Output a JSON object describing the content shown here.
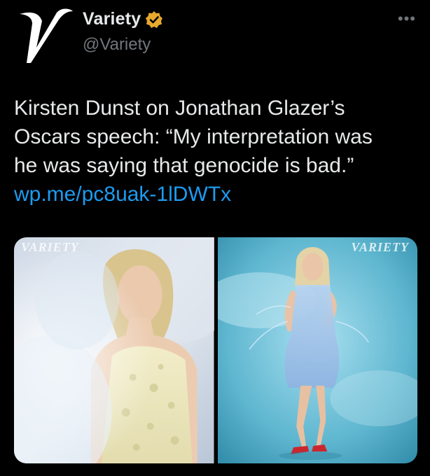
{
  "account": {
    "display_name": "Variety",
    "handle": "@Variety",
    "verified": true,
    "avatar_icon": "variety-v-logo-icon",
    "badge_color": "#e7a82e"
  },
  "menu": {
    "more_label": "•••"
  },
  "tweet": {
    "text": "Kirsten Dunst on Jonathan Glazer’s\nOscars speech: “My interpretation was\nhe was saying that genocide is bad.”",
    "link": "wp.me/pc8uak-1lDWTx",
    "link_color": "#1d9bf0"
  },
  "media": [
    {
      "watermark": "VARIETY",
      "description_icon": "photo-left"
    },
    {
      "watermark": "VARIETY",
      "description_icon": "photo-right"
    }
  ]
}
